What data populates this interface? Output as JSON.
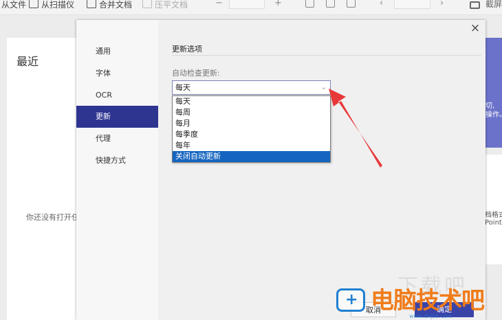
{
  "toolbar": {
    "open_file": "从文件",
    "from_scanner": "从扫描仪",
    "merge_docs": "合并文档",
    "compress_docs": "压平文档",
    "zoom_out": "−",
    "zoom_in": "+",
    "prev_page": "‹",
    "next_page": "›",
    "screenshot": "截屏"
  },
  "background": {
    "recent_title": "最近",
    "empty_message": "你还没有打开任",
    "promo_line1": "切,",
    "promo_line2": "操作。",
    "right_line1": "档格式",
    "right_line2": "Point"
  },
  "dialog": {
    "nav": [
      {
        "label": "通用"
      },
      {
        "label": "字体"
      },
      {
        "label": "OCR"
      },
      {
        "label": "更新"
      },
      {
        "label": "代理"
      },
      {
        "label": "快捷方式"
      }
    ],
    "active_nav": "更新",
    "close_symbol": "×",
    "section_title": "更新选项",
    "field_label": "自动检查更新:",
    "select": {
      "value": "每天",
      "caret": "⌄",
      "options": [
        "每天",
        "每周",
        "每月",
        "每季度",
        "每年",
        "关闭自动更新"
      ],
      "highlighted": "关闭自动更新"
    },
    "cancel_label": "取消",
    "ok_label": "确定"
  },
  "watermark": {
    "text": "电脑技术吧",
    "url": "www.dnjsb.com",
    "ghost": "下载吧"
  },
  "colors": {
    "nav_active": "#2e3591",
    "option_highlight": "#1565c0",
    "annotation_arrow": "#e8393a",
    "watermark_orange": "#f07c1a",
    "watermark_blue": "#1f7fd0"
  }
}
